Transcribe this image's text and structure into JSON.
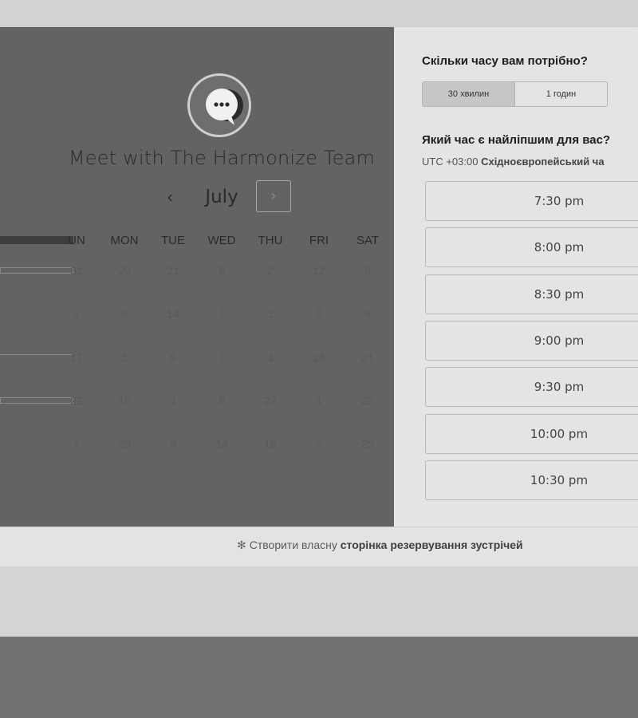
{
  "left": {
    "title": "Meet with The Harmonize Team",
    "month": "July",
    "prev_glyph": "‹",
    "next_glyph": "›",
    "days_of_week": [
      "UN",
      "MON",
      "TUE",
      "WED",
      "THU",
      "FRI",
      "SAT"
    ],
    "weeks": [
      [
        "31",
        "20",
        "21",
        "9",
        "2",
        "12",
        "6"
      ],
      [
        "1",
        "8",
        "14",
        "7",
        "1",
        "9",
        "9"
      ],
      [
        "17",
        "5",
        "9",
        "7",
        "3",
        "26",
        "21"
      ],
      [
        "22",
        "18",
        "4",
        "9",
        "27",
        "1",
        "22"
      ],
      [
        "7",
        "29",
        "6",
        "14",
        "15",
        "5",
        "25"
      ]
    ]
  },
  "right": {
    "duration_question": "Скільки часу вам потрібно?",
    "durations": [
      {
        "label": "30 хвилин",
        "active": true
      },
      {
        "label": "1 годин",
        "active": false
      }
    ],
    "time_question": "Який час є найліпшим для вас?",
    "timezone_offset": "UTC +03:00",
    "timezone_name": "Східноєвропейський ча",
    "slots": [
      "7:30 pm",
      "8:00 pm",
      "8:30 pm",
      "9:00 pm",
      "9:30 pm",
      "10:00 pm",
      "10:30 pm"
    ]
  },
  "footer": {
    "icon": "sprocket-icon",
    "prefix": "Створити власну",
    "bold": "сторінка резервування зустрічей"
  },
  "colors": {
    "left_panel_bg": "#636363",
    "right_panel_bg": "#e4e4e4",
    "footer_bg": "#e3e3e3"
  }
}
